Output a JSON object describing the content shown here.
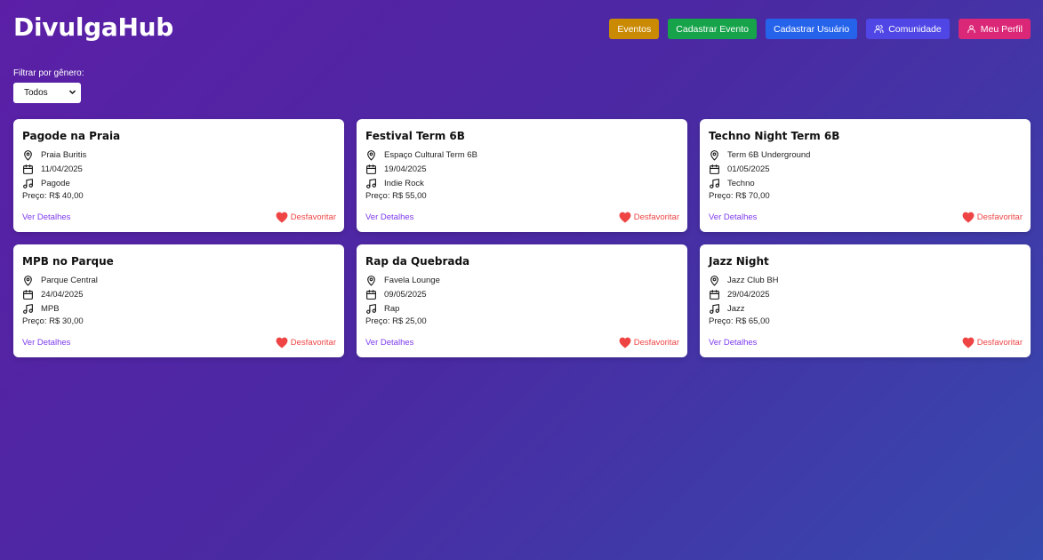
{
  "app": {
    "title": "DivulgaHub"
  },
  "nav": [
    {
      "label": "Eventos",
      "color": "#ca8a04",
      "icon": ""
    },
    {
      "label": "Cadastrar Evento",
      "color": "#16a34a",
      "icon": ""
    },
    {
      "label": "Cadastrar Usuário",
      "color": "#2563eb",
      "icon": ""
    },
    {
      "label": "Comunidade",
      "color": "#4f46e5",
      "icon": "users-icon"
    },
    {
      "label": "Meu Perfil",
      "color": "#db2777",
      "icon": "user-icon"
    }
  ],
  "filter": {
    "label": "Filtrar por gênero:",
    "selected": "Todos"
  },
  "actions": {
    "details": "Ver Detalhes",
    "unfavorite": "Desfavoritar"
  },
  "events": [
    {
      "title": "Pagode na Praia",
      "location": "Praia Buritis",
      "date": "11/04/2025",
      "genre": "Pagode",
      "price": "Preço: R$ 40,00"
    },
    {
      "title": "Festival Term 6B",
      "location": "Espaço Cultural Term 6B",
      "date": "19/04/2025",
      "genre": "Indie Rock",
      "price": "Preço: R$ 55,00"
    },
    {
      "title": "Techno Night Term 6B",
      "location": "Term 6B Underground",
      "date": "01/05/2025",
      "genre": "Techno",
      "price": "Preço: R$ 70,00"
    },
    {
      "title": "MPB no Parque",
      "location": "Parque Central",
      "date": "24/04/2025",
      "genre": "MPB",
      "price": "Preço: R$ 30,00"
    },
    {
      "title": "Rap da Quebrada",
      "location": "Favela Lounge",
      "date": "09/05/2025",
      "genre": "Rap",
      "price": "Preço: R$ 25,00"
    },
    {
      "title": "Jazz Night",
      "location": "Jazz Club BH",
      "date": "29/04/2025",
      "genre": "Jazz",
      "price": "Preço: R$ 65,00"
    }
  ]
}
